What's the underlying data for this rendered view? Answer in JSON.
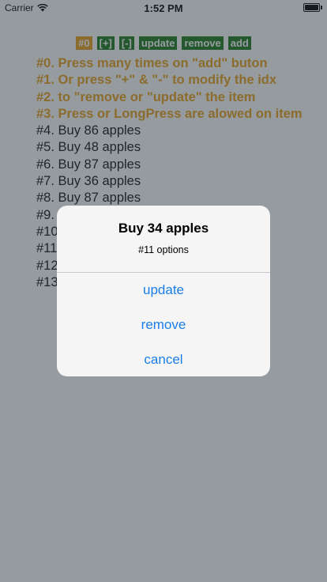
{
  "status_bar": {
    "carrier": "Carrier",
    "time": "1:52 PM",
    "wifi_icon": "wifi-icon",
    "battery_icon": "battery-icon",
    "battery_level": 1.0
  },
  "toolbar": {
    "index_label": "#0",
    "plus_label": "[+]",
    "minus_label": "[-]",
    "update_label": "update",
    "remove_label": "remove",
    "add_label": "add"
  },
  "list": {
    "instructions": [
      "#0. Press many times on \"add\" buton",
      "#1. Or press \"+\" & \"-\" to modify the idx",
      "#2. to \"remove or \"update\" the item",
      "#3. Press or LongPress are alowed on item"
    ],
    "items": [
      "#4. Buy 86 apples",
      "#5. Buy 48 apples",
      "#6. Buy 87 apples",
      "#7. Buy 36 apples",
      "#8. Buy 87 apples",
      "#9.",
      "#10",
      "#11.",
      "#12",
      "#13"
    ]
  },
  "alert": {
    "title": "Buy 34 apples",
    "message": "#11 options",
    "actions": {
      "update": "update",
      "remove": "remove",
      "cancel": "cancel"
    }
  },
  "colors": {
    "accent_orange": "#e8a019",
    "button_green": "#1a7a1a",
    "action_blue": "#1a7ee8"
  }
}
